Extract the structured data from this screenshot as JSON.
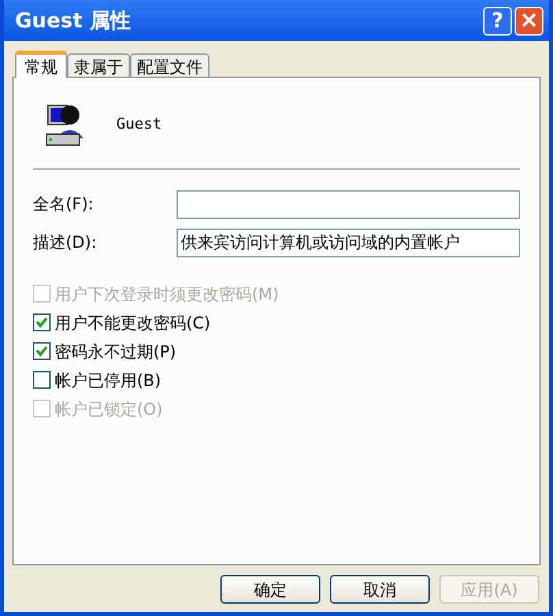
{
  "window": {
    "title": "Guest 属性",
    "help": "?",
    "close": "×"
  },
  "tabs": [
    {
      "label": "常规",
      "selected": true
    },
    {
      "label": "隶属于",
      "selected": false
    },
    {
      "label": "配置文件",
      "selected": false
    }
  ],
  "user": {
    "name": "Guest"
  },
  "fields": [
    {
      "label": "全名(F):"
    },
    {
      "label": "描述(D):",
      "value": "供来宾访问计算机或访问域的内置帐户"
    }
  ],
  "options": [
    {
      "label": "用户下次登录时须更改密码(M)",
      "checked": false,
      "disabled": true
    },
    {
      "label": "用户不能更改密码(C)",
      "checked": true,
      "disabled": false
    },
    {
      "label": "密码永不过期(P)",
      "checked": true,
      "disabled": false
    },
    {
      "label": "帐户已停用(B)",
      "checked": false,
      "disabled": false
    },
    {
      "label": "帐户已锁定(O)",
      "checked": false,
      "disabled": true
    }
  ],
  "buttons": [
    {
      "label": "确定",
      "disabled": false
    },
    {
      "label": "取消",
      "disabled": false
    },
    {
      "label": "应用(A)",
      "disabled": true
    }
  ]
}
